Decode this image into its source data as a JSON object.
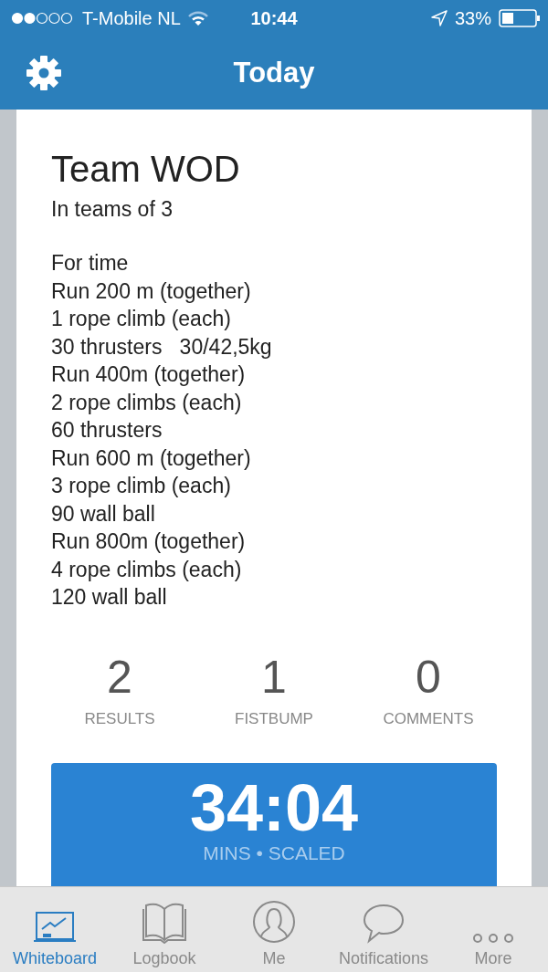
{
  "status_bar": {
    "carrier": "T-Mobile NL",
    "time": "10:44",
    "battery": "33%"
  },
  "nav": {
    "title": "Today"
  },
  "workout": {
    "title": "Team WOD",
    "subtitle": "In teams of 3",
    "lines": [
      "For time",
      "Run 200 m (together)",
      "1 rope climb (each)",
      "30 thrusters   30/42,5kg",
      "Run 400m (together)",
      "2 rope climbs (each)",
      "60 thrusters",
      "Run 600 m (together)",
      "3 rope climb (each)",
      "90 wall ball",
      "Run 800m (together)",
      "4 rope climbs (each)",
      "120 wall ball"
    ]
  },
  "stats": [
    {
      "count": "2",
      "label": "RESULTS"
    },
    {
      "count": "1",
      "label": "FISTBUMP"
    },
    {
      "count": "0",
      "label": "COMMENTS"
    }
  ],
  "result": {
    "time": "34:04",
    "detail": "MINS • SCALED"
  },
  "tabs": [
    {
      "kind": "whiteboard",
      "label": "Whiteboard",
      "selected": true
    },
    {
      "kind": "logbook",
      "label": "Logbook",
      "selected": false
    },
    {
      "kind": "me",
      "label": "Me",
      "selected": false
    },
    {
      "kind": "notifications",
      "label": "Notifications",
      "selected": false
    },
    {
      "kind": "more",
      "label": "More",
      "selected": false
    }
  ]
}
